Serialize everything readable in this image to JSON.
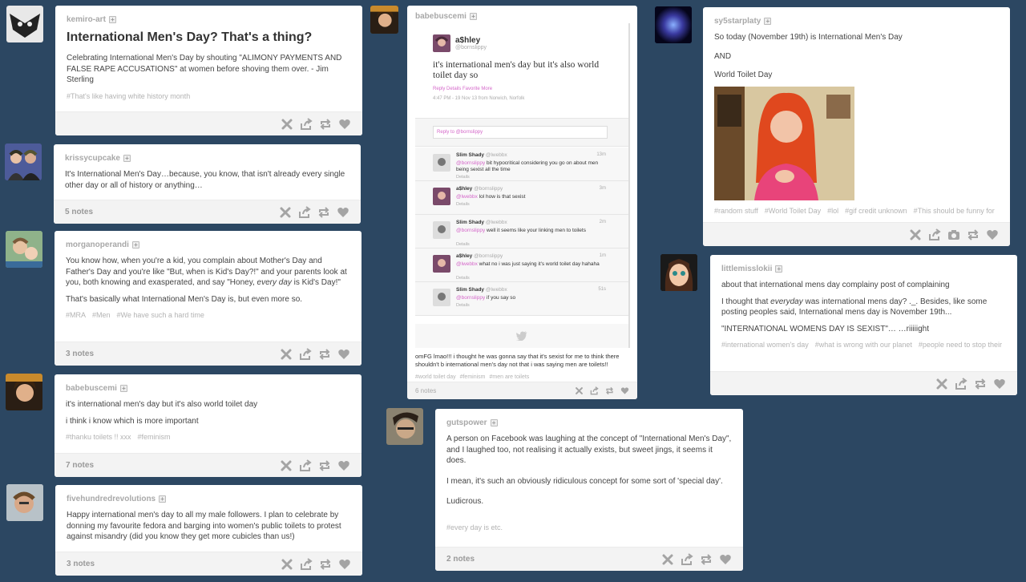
{
  "colors": {
    "background": "#2c4762",
    "accent": "#d467c9",
    "tag": "#b3b3b3"
  },
  "actions": [
    "x-icon",
    "share-icon",
    "reblog-icon",
    "heart-icon"
  ],
  "posts": {
    "p1": {
      "user": "kemiro-art",
      "title": "International Men's Day? That's a thing?",
      "body": "Celebrating International Men's Day by shouting \"ALIMONY PAYMENTS AND FALSE RAPE ACCUSATIONS\" at women before shoving them over. - Jim Sterling",
      "tags": [
        "#That's like having white history month"
      ],
      "notes": ""
    },
    "p2": {
      "user": "krissycupcake",
      "body": "It's International Men's Day…because, you know, that isn't already every single other day or all of history or anything…",
      "notes": "5 notes"
    },
    "p3": {
      "user": "morganoperandi",
      "body1_a": "You know how, when you're a kid, you complain about Mother's Day and Father's Day and you're like \"But, when is Kid's Day?!\" and your parents look at you, both knowing and exasperated, and say \"Honey, ",
      "body1_em": "every day",
      "body1_b": " is Kid's Day!\"",
      "body2": "That's basically what International Men's Day is, but even more so.",
      "tags": [
        "#MRA",
        "#Men",
        "#We have such a hard time"
      ],
      "notes": "3 notes"
    },
    "p4": {
      "user": "babebuscemi",
      "body1": "it's international men's day but it's also world toilet day",
      "body2": "i think i know which is more important",
      "tags": [
        "#thanku toilets !! xxx",
        "#feminism"
      ],
      "notes": "7 notes"
    },
    "p5": {
      "user": "fivehundredrevolutions",
      "body": "Happy international men's day to all my male followers. I plan to celebrate by donning my favourite fedora and barging into women's public toilets to protest against misandry (did you know they get more cubicles than us!)",
      "notes": "3 notes"
    },
    "p6": {
      "user": "babebuscemi",
      "tweet": {
        "name": "a$hley",
        "handle": "@bornslippy",
        "text": "it's international men's day but it's also world toilet day so",
        "actions": "Reply   Details   Favorite   More",
        "meta": "4:47 PM - 19 Nov 13 from Norwich, Norfolk",
        "reply_placeholder": "Reply to @bornslippy"
      },
      "replies": [
        {
          "name": "Slim Shady",
          "handle": "@lwebbx",
          "time": "13m",
          "mention": "@bornslippy",
          "text": " bit hypocritical considering you go on about men being sexist all the time",
          "details": "Details"
        },
        {
          "name": "a$hley",
          "handle": "@bornslippy",
          "time": "3m",
          "mention": "@lwebbx",
          "text": " lol how is that sexist",
          "details": "Details"
        },
        {
          "name": "Slim Shady",
          "handle": "@lwebbx",
          "time": "2m",
          "mention": "@bornslippy",
          "text": " well it seems like your linking men to toilets",
          "details": "Details"
        },
        {
          "name": "a$hley",
          "handle": "@bornslippy",
          "time": "1m",
          "mention": "@lwebbx",
          "text": " what no i was just saying it's world toilet day hahaha",
          "details": "Details"
        },
        {
          "name": "Slim Shady",
          "handle": "@lwebbx",
          "time": "51s",
          "mention": "@bornslippy",
          "text": " if you say so",
          "details": "Details"
        }
      ],
      "caption": "omFG lmao!!! i thought he was gonna say that it's sexist for me to think there shouldn't b international men's day not that i was saying men are toilets!!",
      "tags": [
        "#world toilet day",
        "#feminism",
        "#men are toilets"
      ],
      "notes": "6 notes"
    },
    "p7": {
      "user": "gutspower",
      "body1": "A person on Facebook was laughing at the concept of  \"International Men's Day\", and I laughed too, not realising it actually exists, but sweet jings, it seems it does.",
      "body2": "I mean, it's such an obviously ridiculous concept for some sort of 'special day'.",
      "body3": "Ludicrous.",
      "tags": [
        "#every day is etc."
      ],
      "notes": "2 notes"
    },
    "p8": {
      "user": "sy5starplaty",
      "body1": "So today (November 19th) is International Men's Day",
      "body2": "AND",
      "body3": "World Toilet Day",
      "tags": [
        "#random stuff",
        "#World Toilet Day",
        "#lol",
        "#gif credit unknown",
        "#This should be funny for"
      ],
      "notes": ""
    },
    "p9": {
      "user": "littlemisslokii",
      "body1": "about that international mens day complainy post of complaining",
      "body2_a": "I thought that ",
      "body2_em": "everyday",
      "body2_b": " was international mens day? ._. Besides, like some posting peoples said, International mens day is November 19th...",
      "body3": "\"INTERNATIONAL WOMENS DAY IS SEXIST\"… …riiiiight",
      "tags": [
        "#international women's day",
        "#what is wrong with our planet",
        "#people need to stop their"
      ],
      "notes": ""
    }
  }
}
